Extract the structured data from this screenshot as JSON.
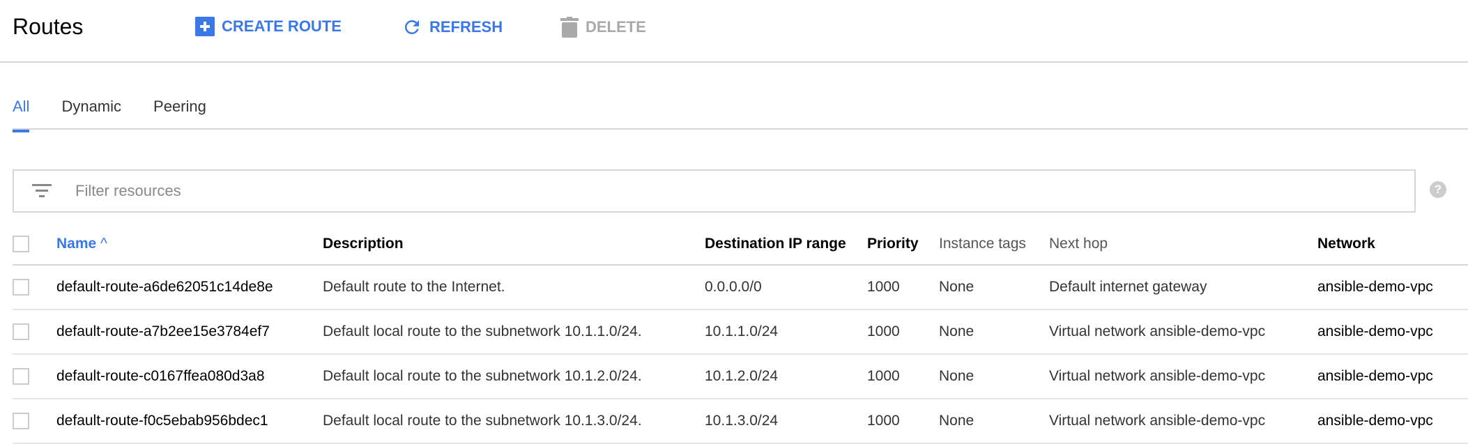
{
  "header": {
    "title": "Routes",
    "create_label": "CREATE ROUTE",
    "refresh_label": "REFRESH",
    "delete_label": "DELETE"
  },
  "tabs": [
    {
      "label": "All"
    },
    {
      "label": "Dynamic"
    },
    {
      "label": "Peering"
    }
  ],
  "filter": {
    "placeholder": "Filter resources",
    "value": ""
  },
  "help_icon": "?",
  "table": {
    "columns": [
      "Name",
      "Description",
      "Destination IP range",
      "Priority",
      "Instance tags",
      "Next hop",
      "Network"
    ],
    "sort_indicator": "^",
    "rows": [
      [
        "default-route-a6de62051c14de8e",
        "Default route to the Internet.",
        "0.0.0.0/0",
        "1000",
        "None",
        "Default internet gateway",
        "ansible-demo-vpc"
      ],
      [
        "default-route-a7b2ee15e3784ef7",
        "Default local route to the subnetwork 10.1.1.0/24.",
        "10.1.1.0/24",
        "1000",
        "None",
        "Virtual network ansible-demo-vpc",
        "ansible-demo-vpc"
      ],
      [
        "default-route-c0167ffea080d3a8",
        "Default local route to the subnetwork 10.1.2.0/24.",
        "10.1.2.0/24",
        "1000",
        "None",
        "Virtual network ansible-demo-vpc",
        "ansible-demo-vpc"
      ],
      [
        "default-route-f0c5ebab956bdec1",
        "Default local route to the subnetwork 10.1.3.0/24.",
        "10.1.3.0/24",
        "1000",
        "None",
        "Virtual network ansible-demo-vpc",
        "ansible-demo-vpc"
      ]
    ]
  },
  "colors": {
    "accent": "#3b78e7",
    "disabled": "#a9a9a9",
    "border": "#d6d6d6"
  }
}
